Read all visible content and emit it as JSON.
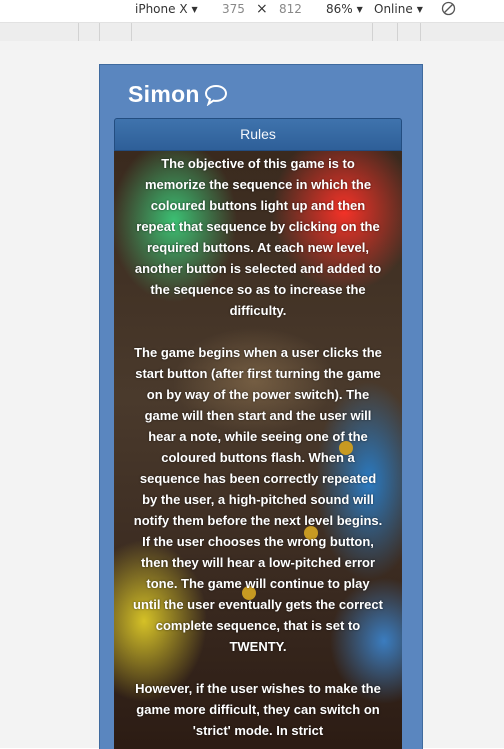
{
  "devtools": {
    "device": "iPhone X",
    "width": "375",
    "times": "×",
    "height": "812",
    "zoom": "86%",
    "network": "Online"
  },
  "app": {
    "title": "Simon",
    "title_icon": "speech-bubble-icon"
  },
  "rules": {
    "heading": "Rules",
    "paragraphs": [
      "The objective of this game is to memorize the sequence in which the coloured buttons light up and then repeat that sequence by clicking on the required buttons. At each new level, another button is selected and added to the sequence so as to increase the difficulty.",
      "The game begins when a user clicks the start button (after first turning the game on by way of the power switch). The game will then start and the user will hear a note, while seeing one of the coloured buttons flash. When a sequence has been correctly repeated by the user, a high-pitched sound will notify them before the next level begins. If the user chooses the wrong button, then they will hear a low-pitched error tone. The game will continue to play until the user eventually gets the correct complete sequence, that is set to TWENTY.",
      "However, if the user wishes to make the game more difficult, they can switch on 'strict' mode. In strict"
    ]
  },
  "colors": {
    "header_blue": "#5a86bf",
    "rules_bar": "#3f73ad"
  }
}
